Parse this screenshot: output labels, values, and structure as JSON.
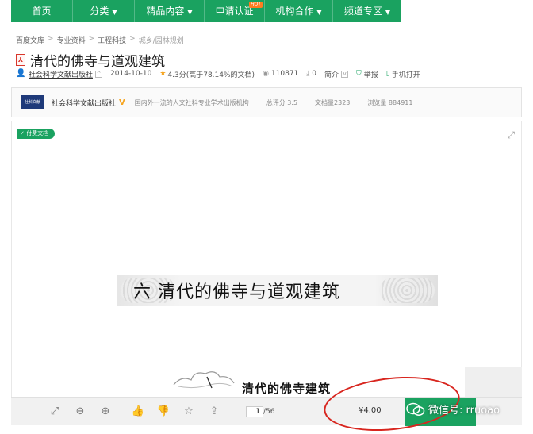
{
  "nav": {
    "items": [
      {
        "label": "首页",
        "caret": false
      },
      {
        "label": "分类",
        "caret": true
      },
      {
        "label": "精品内容",
        "caret": true
      },
      {
        "label": "申请认证",
        "caret": false,
        "badge": "HOT"
      },
      {
        "label": "机构合作",
        "caret": true
      },
      {
        "label": "频道专区",
        "caret": true
      }
    ]
  },
  "breadcrumb": [
    "百度文库",
    "专业资料",
    "工程科技",
    "城乡/园林规划"
  ],
  "document": {
    "title": "清代的佛寺与道观建筑",
    "publisher": "社会科学文献出版社",
    "date": "2014-10-10",
    "rating": "4.3分(高于78.14%的文档)",
    "views": "110871",
    "downloads": "0",
    "intro_label": "简介",
    "report_label": "举报",
    "mobile_label": "手机打开"
  },
  "publisher_bar": {
    "logo_text": "社科文献",
    "name": "社会科学文献出版社",
    "verified": "V",
    "description": "国内外一流的人文社科专业学术出版机构",
    "total_rating": "总评分 3.5",
    "doc_count": "文档量2323",
    "view_count": "浏览量 884911"
  },
  "viewer": {
    "paid_badge": "付费文档",
    "slide_heading": "六   清代的佛寺与道观建筑",
    "slide_subheading": "清代的佛寺建筑"
  },
  "toolbar": {
    "current_page": "1",
    "total_pages": "/56",
    "price": "¥4.00"
  },
  "watermark": {
    "text": "微信号: rruoao"
  },
  "colors": {
    "brand_green": "#1aa260",
    "annotation_red": "#d8261f",
    "star": "#f6a623"
  }
}
